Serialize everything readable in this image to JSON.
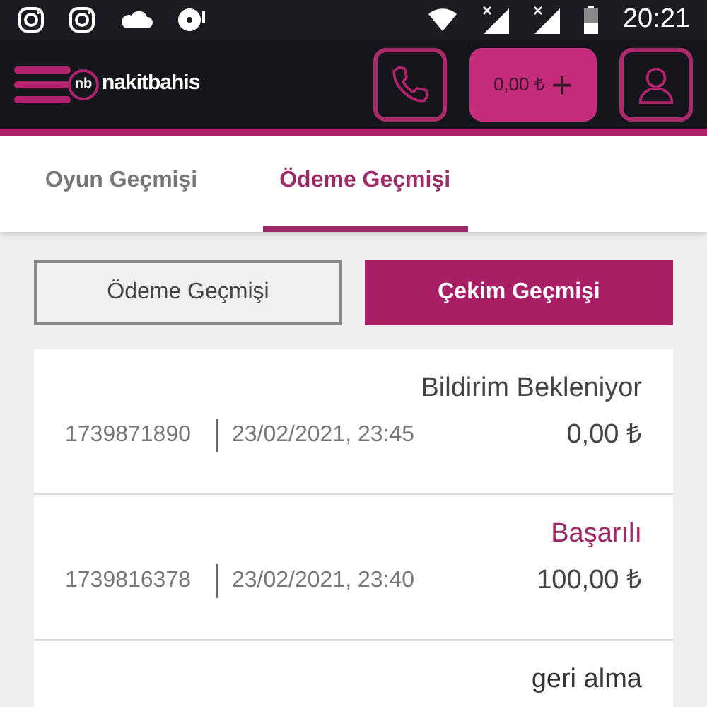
{
  "status_bar": {
    "time": "20:21"
  },
  "header": {
    "logo_mark": "nb",
    "logo_text": "nakitbahis",
    "balance": "0,00 ₺",
    "add_symbol": "+"
  },
  "tabs": [
    {
      "label": "Oyun Geçmişi",
      "selected": false
    },
    {
      "label": "Ödeme Geçmişi",
      "selected": true
    }
  ],
  "toggle": [
    {
      "label": "Ödeme Geçmişi",
      "selected": false
    },
    {
      "label": "Çekim Geçmişi",
      "selected": true
    }
  ],
  "transactions": [
    {
      "status": "Bildirim Bekleniyor",
      "color": "#444444",
      "id": "1739871890",
      "date": "23/02/2021, 23:45",
      "amount": "0,00 ₺"
    },
    {
      "status": "Başarılı",
      "color": "#9c2a67",
      "id": "1739816378",
      "date": "23/02/2021, 23:40",
      "amount": "100,00 ₺"
    },
    {
      "status": "geri alma",
      "color": "#333333"
    }
  ]
}
